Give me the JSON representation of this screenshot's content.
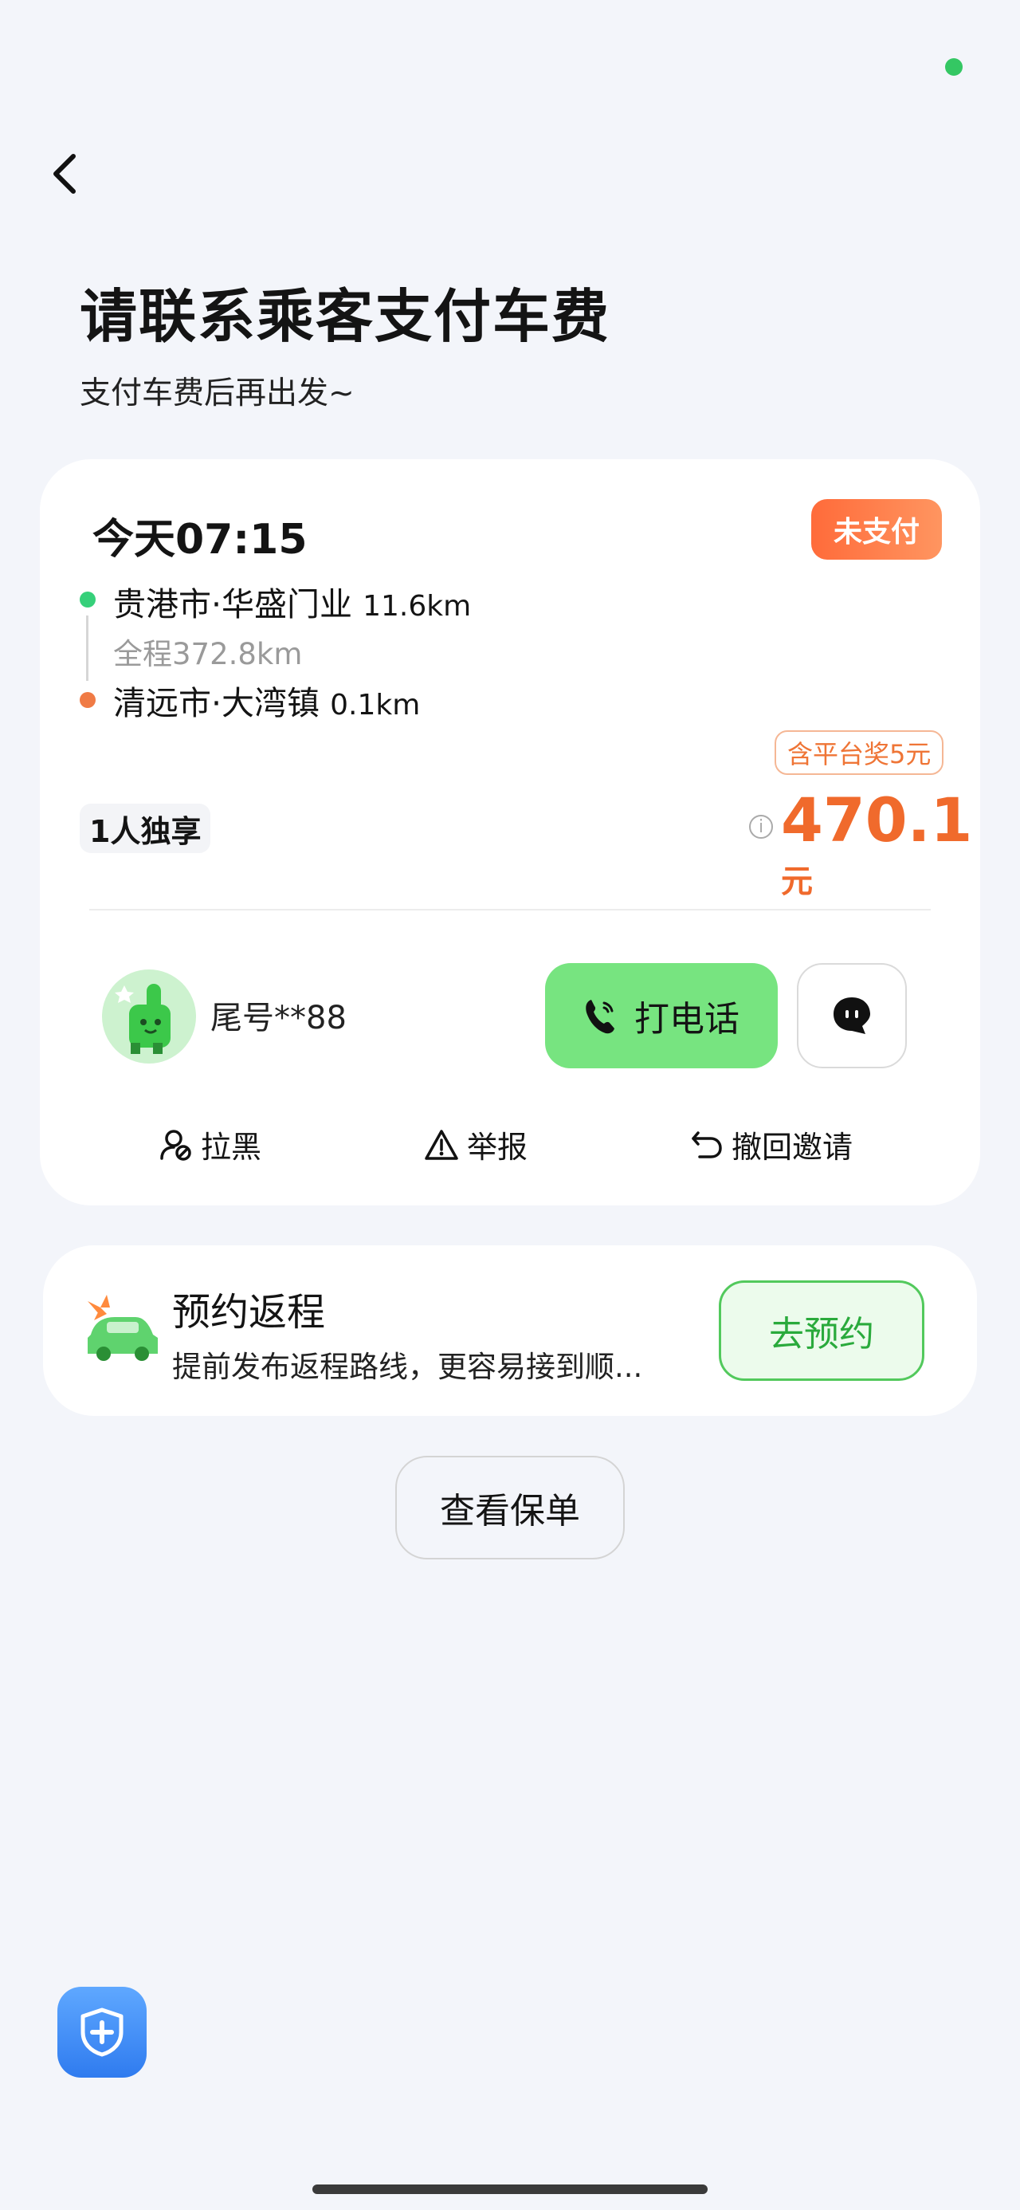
{
  "header": {
    "title": "请联系乘客支付车费",
    "subtitle": "支付车费后再出发~"
  },
  "order": {
    "time": "今天07:15",
    "status_badge": "未支付",
    "origin": {
      "place": "贵港市·华盛门业",
      "distance": "11.6km"
    },
    "total_distance": "全程372.8km",
    "destination": {
      "place": "清远市·大湾镇",
      "distance": "0.1km"
    },
    "reward_tag": "含平台奖5元",
    "ride_type": "1人独享",
    "info_glyph": "i",
    "price": "470.1",
    "price_unit": "元",
    "passenger_phone_tail": "尾号**88",
    "call_button": "打电话",
    "actions": {
      "block": "拉黑",
      "report": "举报",
      "revoke": "撤回邀请"
    }
  },
  "return_trip": {
    "title": "预约返程",
    "description": "提前发布返程路线，更容易接到顺...",
    "button": "去预约"
  },
  "policy_button": "查看保单",
  "colors": {
    "accent_green": "#77e480",
    "price_orange": "#f06a2c",
    "badge_orange": "#ff7a45",
    "safety_blue": "#3f8cf7"
  },
  "icons": [
    "back-arrow-icon",
    "phone-icon",
    "chat-bubble-icon",
    "block-user-icon",
    "warning-icon",
    "undo-icon",
    "car-pinwheel-icon",
    "shield-plus-icon"
  ]
}
